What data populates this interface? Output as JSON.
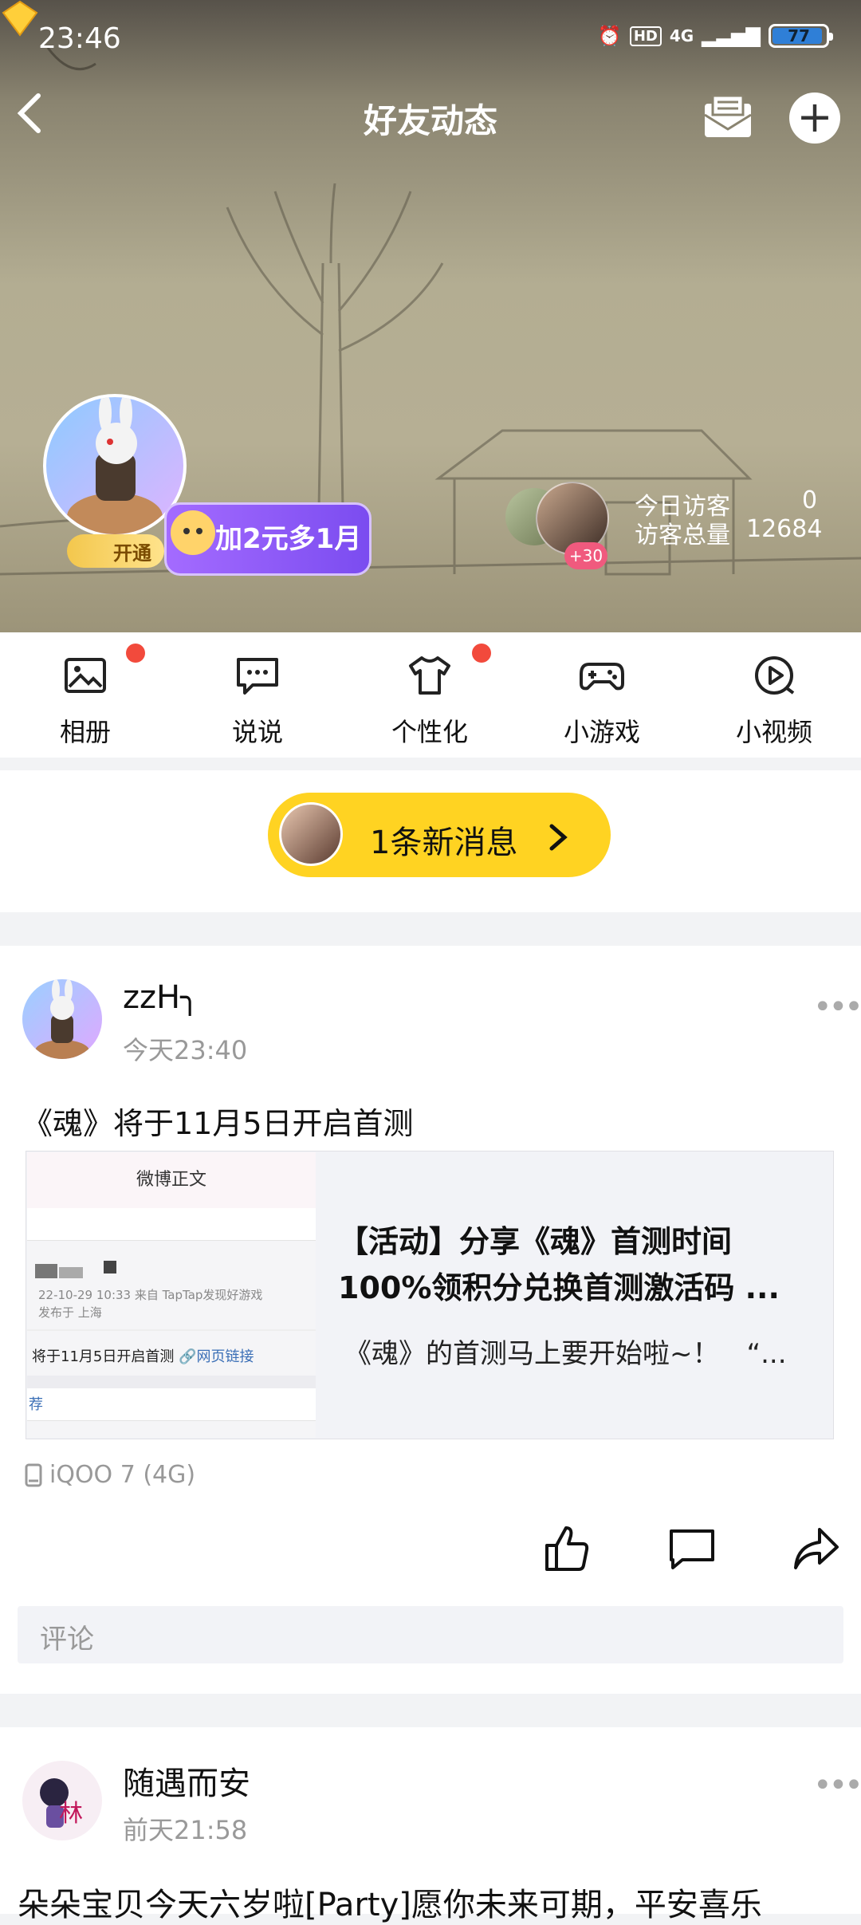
{
  "status_bar": {
    "time": "23:46",
    "network": "4G",
    "battery": "77"
  },
  "header": {
    "title": "好友动态"
  },
  "profile": {
    "vip_label": "开通",
    "promo_text": "加2元多1月",
    "visitor_badge": "+30",
    "today_visitors_label": "今日访客",
    "today_visitors": "0",
    "total_visitors_label": "访客总量",
    "total_visitors": "12684"
  },
  "quick_nav": {
    "items": [
      {
        "label": "相册",
        "icon": "image-icon",
        "dot": true
      },
      {
        "label": "说说",
        "icon": "chat-bubble-icon",
        "dot": false
      },
      {
        "label": "个性化",
        "icon": "shirt-icon",
        "dot": true
      },
      {
        "label": "小游戏",
        "icon": "gamepad-icon",
        "dot": false
      },
      {
        "label": "小视频",
        "icon": "play-circle-icon",
        "dot": false
      }
    ]
  },
  "new_message": {
    "label": "1条新消息"
  },
  "posts": [
    {
      "author": "zzH╮",
      "time": "今天23:40",
      "text": "《魂》将于11月5日开启首测",
      "link": {
        "thumb_header": "微博正文",
        "thumb_meta": "22-10-29 10:33  来自 TapTap发现好游戏",
        "thumb_location": "发布于 上海",
        "thumb_text": "将于11月5日开启首测",
        "thumb_link": "网页链接",
        "thumb_more": "荐",
        "title": "【活动】分享《魂》首测时间100%领积分兑换首测激活码 ...",
        "desc": "《魂》的首测马上要开始啦~！　“..."
      },
      "device": "iQOO 7 (4G)",
      "comment_placeholder": "评论"
    },
    {
      "author": "随遇而安",
      "time": "前天21:58",
      "text": "朵朵宝贝今天六岁啦[Party]愿你未来可期，平安喜乐"
    }
  ],
  "colors": {
    "accent_yellow": "#ffd322",
    "badge_red": "#f24a3c",
    "vip_purple": "#8a5cf5"
  }
}
